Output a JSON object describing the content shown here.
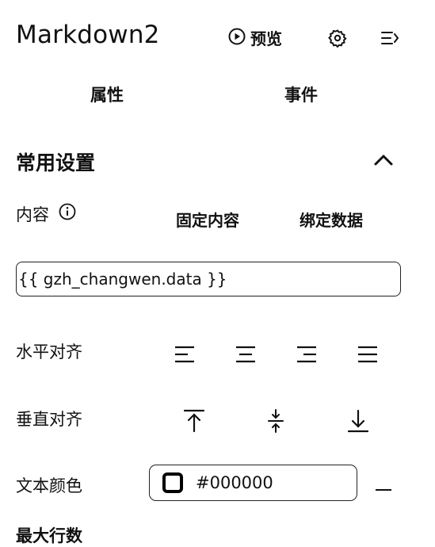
{
  "header": {
    "title": "Markdown2",
    "preview_label": "预览",
    "icons": {
      "preview": "play-circle-icon",
      "settings": "gear-icon",
      "collapse": "collapse-panel-icon"
    }
  },
  "tabs": [
    {
      "label": "属性"
    },
    {
      "label": "事件"
    }
  ],
  "section": {
    "title": "常用设置",
    "toggle_icon": "chevron-up-icon"
  },
  "content": {
    "label": "内容",
    "info_icon": "info-icon",
    "modes": [
      "固定内容",
      "绑定数据"
    ],
    "value": "{{ gzh_changwen.data }}"
  },
  "h_align": {
    "label": "水平对齐",
    "options": [
      "align-left-icon",
      "align-center-icon",
      "align-right-icon",
      "align-justify-icon"
    ]
  },
  "v_align": {
    "label": "垂直对齐",
    "options": [
      "align-top-icon",
      "align-middle-icon",
      "align-bottom-icon"
    ]
  },
  "text_color": {
    "label": "文本颜色",
    "value": "#000000",
    "swatch_color": "#000000",
    "remove_icon": "minus-icon"
  },
  "next_row": {
    "label": "最大行数"
  }
}
